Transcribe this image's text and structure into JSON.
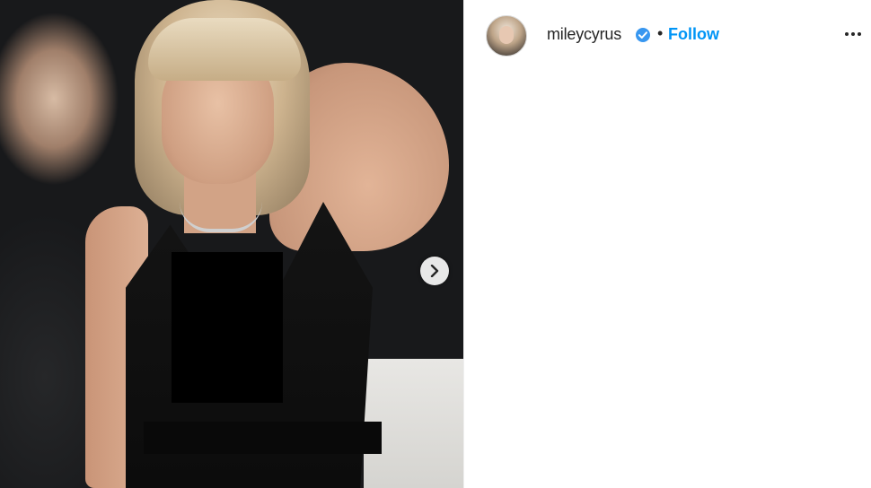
{
  "post": {
    "username": "mileycyrus",
    "separator": "•",
    "follow_label": "Follow",
    "verified": true,
    "accent_color": "#0095f6",
    "icons": {
      "verified": "verified-badge-icon",
      "more": "more-options-icon",
      "next": "chevron-right-icon"
    }
  }
}
